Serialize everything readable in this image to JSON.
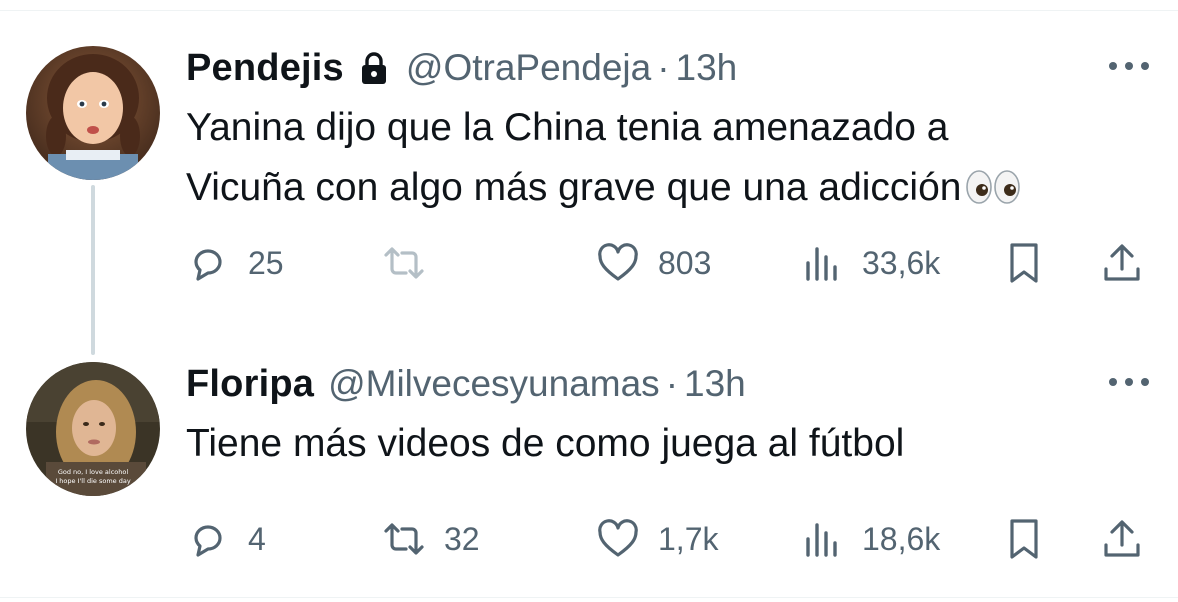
{
  "tweets": [
    {
      "display_name": "Pendejis",
      "protected": true,
      "handle": "@OtraPendeja",
      "separator": "·",
      "time": "13h",
      "text_line1": "Yanina dijo que la China tenia amenazado a",
      "text_line2": "Vicuña con algo más grave que una adicción",
      "emoji": "eyes",
      "replies": "25",
      "retweets": "",
      "likes": "803",
      "views": "33,6k"
    },
    {
      "display_name": "Floripa",
      "protected": false,
      "handle": "@Milvecesyunamas",
      "separator": "·",
      "time": "13h",
      "text_line1": "Tiene más videos de como juega al fútbol",
      "replies": "4",
      "retweets": "32",
      "likes": "1,7k",
      "views": "18,6k"
    }
  ],
  "avatar2_caption_line1": "God no, I love alcohol",
  "avatar2_caption_line2": "I hope I'll die some day",
  "icons": [
    "lock-icon",
    "more-icon",
    "reply-icon",
    "retweet-icon",
    "like-icon",
    "views-icon",
    "bookmark-icon",
    "share-icon",
    "eyes-emoji"
  ],
  "colors": {
    "text": "#0f1419",
    "secondary": "#536471",
    "thread_line": "#cfd9de",
    "divider": "#eff3f4"
  }
}
